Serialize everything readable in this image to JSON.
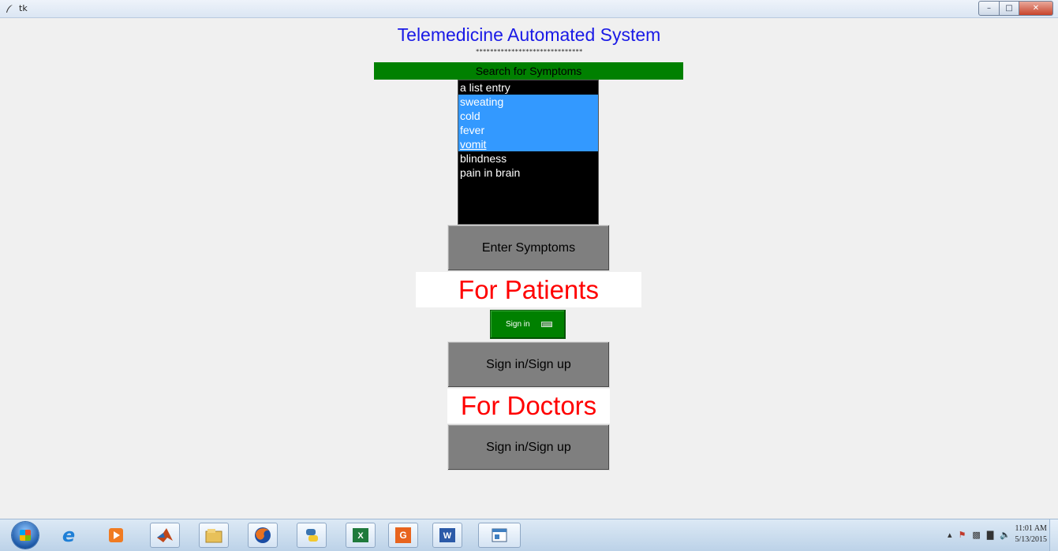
{
  "window": {
    "title": "tk"
  },
  "app": {
    "title": "Telemedicine Automated System",
    "separator": "******************************",
    "search_label": "Search for Symptoms",
    "symptom_list": [
      {
        "label": "a list entry",
        "selected": false
      },
      {
        "label": "sweating",
        "selected": true
      },
      {
        "label": "cold",
        "selected": true
      },
      {
        "label": "fever",
        "selected": true
      },
      {
        "label": "vomit",
        "selected": true,
        "active": true
      },
      {
        "label": "blindness",
        "selected": false
      },
      {
        "label": "pain in brain",
        "selected": false
      }
    ],
    "enter_symptoms_button": "Enter Symptoms",
    "patients_heading": "For Patients",
    "signin_toggle_label": "Sign in",
    "patients_signin_button": "Sign in/Sign up",
    "doctors_heading": "For Doctors",
    "doctors_signin_button": "Sign in/Sign up"
  },
  "colors": {
    "title": "#1a1ae6",
    "search_bar": "#008000",
    "selection": "#3399ff",
    "heading": "#ff0000",
    "button": "#7f7f7f"
  },
  "taskbar": {
    "icons": [
      "start-orb-icon",
      "internet-explorer-icon",
      "media-player-icon",
      "matlab-icon",
      "file-explorer-icon",
      "firefox-icon",
      "python-icon",
      "excel-icon",
      "pdf-icon",
      "word-icon",
      "tk-window-icon"
    ],
    "clock_time": "11:01 AM",
    "clock_date": "5/13/2015"
  }
}
